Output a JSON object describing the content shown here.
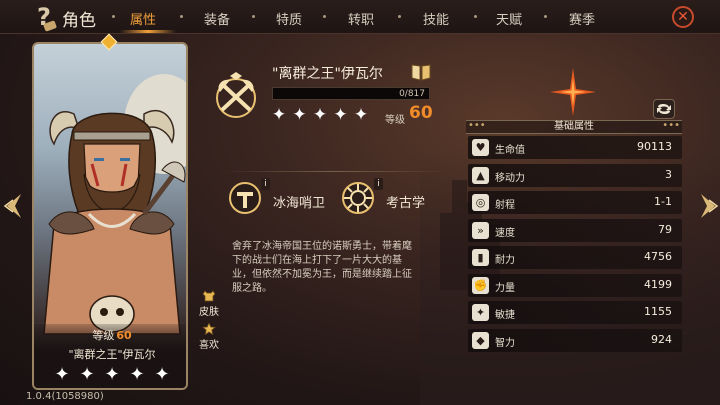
{
  "topbar": {
    "title": "角色",
    "tabs": [
      "属性",
      "装备",
      "特质",
      "转职",
      "技能",
      "天赋",
      "赛季"
    ],
    "active_tab": "属性",
    "close_label": "✕"
  },
  "hero_card": {
    "level_label": "等级",
    "level_value": "60",
    "name": "\"离群之王\"伊瓦尔",
    "stars": 5
  },
  "side_actions": {
    "skin_label": "皮肤",
    "like_label": "喜欢"
  },
  "version": "1.0.4(1058980)",
  "hero_info": {
    "title": "\"离群之王\"伊瓦尔",
    "xp_text": "0/817",
    "xp_progress": 0,
    "stars": 5,
    "level_label": "等级",
    "level_value": "60",
    "skills": [
      {
        "label": "冰海哨卫",
        "info": "i"
      },
      {
        "label": "考古学",
        "info": "i"
      }
    ],
    "description": "舍弃了冰海帝国王位的诺斯勇士，带着麾下的战士们在海上打下了一片大大的基业，但依然不加冕为王，而是继续踏上征服之路。"
  },
  "stats": {
    "header": "基础属性",
    "rows": [
      {
        "icon": "heart-icon",
        "glyph": "♥",
        "label": "生命值",
        "value": "90113"
      },
      {
        "icon": "boot-icon",
        "glyph": "▲",
        "label": "移动力",
        "value": "3"
      },
      {
        "icon": "target-icon",
        "glyph": "◎",
        "label": "射程",
        "value": "1-1"
      },
      {
        "icon": "speed-icon",
        "glyph": "»",
        "label": "速度",
        "value": "79"
      },
      {
        "icon": "stamina-icon",
        "glyph": "▮",
        "label": "耐力",
        "value": "4756"
      },
      {
        "icon": "strength-icon",
        "glyph": "✊",
        "label": "力量",
        "value": "4199"
      },
      {
        "icon": "agility-icon",
        "glyph": "✦",
        "label": "敏捷",
        "value": "1155"
      },
      {
        "icon": "intellect-icon",
        "glyph": "◆",
        "label": "智力",
        "value": "924"
      }
    ]
  }
}
